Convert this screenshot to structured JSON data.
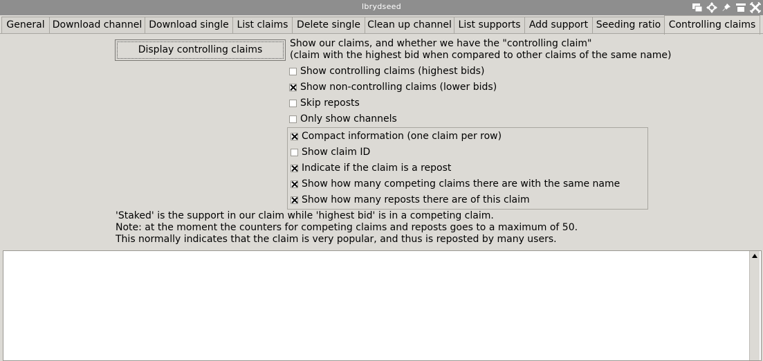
{
  "window": {
    "title": "lbrydseed"
  },
  "titlebar_icons": [
    "windows-icon",
    "move-icon",
    "pin-icon",
    "maximize-icon",
    "close-icon"
  ],
  "tabs": [
    {
      "label": "General"
    },
    {
      "label": "Download channel"
    },
    {
      "label": "Download single"
    },
    {
      "label": "List claims"
    },
    {
      "label": "Delete single"
    },
    {
      "label": "Clean up channel"
    },
    {
      "label": "List supports"
    },
    {
      "label": "Add support"
    },
    {
      "label": "Seeding ratio"
    },
    {
      "label": "Controlling claims"
    }
  ],
  "active_tab": "Controlling claims",
  "main": {
    "button_label": "Display controlling claims",
    "description_line1": "Show our claims, and whether we have the \"controlling claim\"",
    "description_line2": "(claim with the highest bid when compared to other claims of the same name)",
    "options": [
      {
        "label": "Show controlling claims (highest bids)",
        "checked": false
      },
      {
        "label": "Show non-controlling claims (lower bids)",
        "checked": true
      },
      {
        "label": "Skip reposts",
        "checked": false
      },
      {
        "label": "Only show channels",
        "checked": false
      }
    ],
    "display_options": [
      {
        "label": "Compact information (one claim per row)",
        "checked": true
      },
      {
        "label": "Show claim ID",
        "checked": false
      },
      {
        "label": "Indicate if the claim is a repost",
        "checked": true
      },
      {
        "label": "Show how many competing claims there are with the same name",
        "checked": true
      },
      {
        "label": "Show how many reposts there are of this claim",
        "checked": true
      }
    ],
    "notes": [
      "'Staked' is the support in our claim while 'highest bid' is in a competing claim.",
      "Note: at the moment the counters for competing claims and reposts goes to a maximum of 50.",
      "This normally indicates that the claim is very popular, and thus is reposted by many users."
    ]
  },
  "output": {
    "text": ""
  },
  "colors": {
    "background": "#dcdad5",
    "titlebar": "#8e8e8e",
    "output_bg": "#ffffff"
  }
}
